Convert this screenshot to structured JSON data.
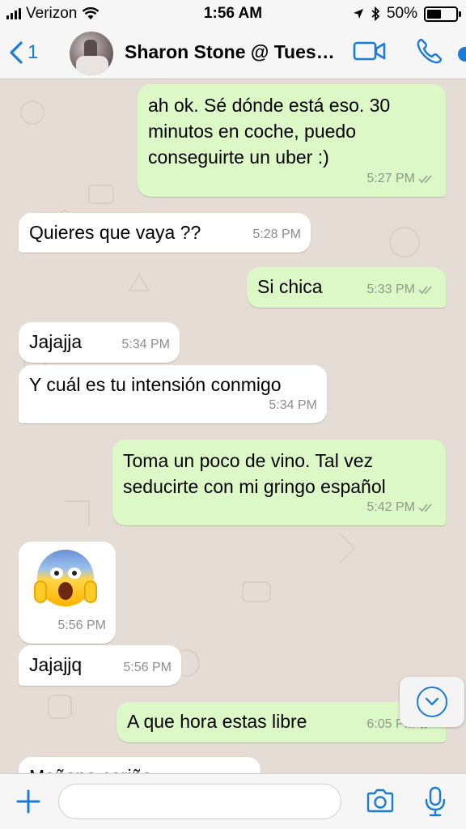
{
  "status_bar": {
    "carrier": "Verizon",
    "time": "1:56 AM",
    "battery": "50%",
    "battery_level": 0.5
  },
  "header": {
    "back_count": "1",
    "title": "Sharon Stone @ Tues…",
    "icons": [
      "back-chevron-icon",
      "video-call-icon",
      "phone-icon"
    ]
  },
  "messages": [
    {
      "dir": "out",
      "text": "ah ok. Sé dónde está eso. 30\nminutos en coche, puedo\nconseguirte un uber :)",
      "time": "5:27 PM",
      "read": true
    },
    {
      "dir": "in",
      "text": "Quieres que vaya ??",
      "time": "5:28 PM"
    },
    {
      "dir": "out",
      "text": "Si chica",
      "time": "5:33 PM",
      "read": true
    },
    {
      "dir": "in",
      "text": "Jajajja",
      "time": "5:34 PM"
    },
    {
      "dir": "in",
      "text": "Y cuál es tu intensión conmigo",
      "time": "5:34 PM"
    },
    {
      "dir": "out",
      "text": "Toma un poco de vino. Tal vez\nseducirte con mi gringo español",
      "time": "5:42 PM",
      "read": true
    },
    {
      "dir": "in",
      "emoji": "face-screaming-in-fear",
      "time": "5:56 PM"
    },
    {
      "dir": "in",
      "text": "Jajajjq",
      "time": "5:56 PM"
    },
    {
      "dir": "out",
      "text": "A que hora estas libre",
      "time": "6:05 PM",
      "read": true
    },
    {
      "dir": "in",
      "text": "Mañana cariño",
      "time": ""
    }
  ],
  "input_bar": {
    "placeholder": "",
    "icons": [
      "plus-icon",
      "camera-icon",
      "microphone-icon"
    ]
  },
  "colors": {
    "accent": "#1a7cd8",
    "chat_background": "#e5ddd5",
    "outgoing_bubble": "#dcf8c6",
    "incoming_bubble": "#ffffff"
  }
}
